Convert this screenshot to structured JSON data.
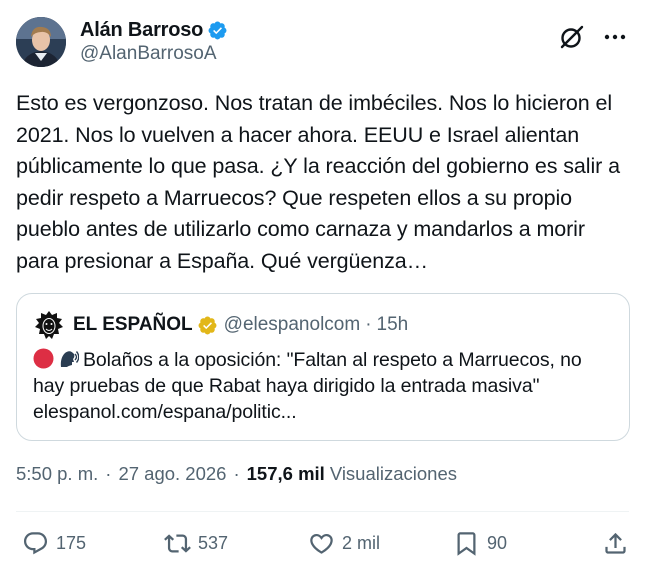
{
  "author": {
    "name": "Alán Barroso",
    "handle": "@AlanBarrosoA"
  },
  "icons": {
    "verified": "verified-badge-icon",
    "grok": "grok-icon",
    "more": "more-icon",
    "reply": "reply-icon",
    "retweet": "retweet-icon",
    "like": "heart-icon",
    "bookmark": "bookmark-icon",
    "share": "share-icon"
  },
  "tweet": {
    "text": "Esto es vergonzoso. Nos tratan de imbéciles. Nos lo hicieron el 2021. Nos lo vuelven a hacer ahora. EEUU e Israel alientan públicamente lo que pasa. ¿Y la reacción del gobierno es salir a pedir respeto a Marruecos? Que respeten ellos a su propio pueblo antes de utilizarlo como carnaza y mandarlos a morir para presionar a España. Qué vergüenza…"
  },
  "quote": {
    "name": "EL ESPAÑOL",
    "handle": "@elespanolcom",
    "separator": "·",
    "time": "15h",
    "text": "Bolaños a la oposición: \"Faltan al respeto a Marruecos, no hay pruebas de que Rabat haya dirigido la entrada masiva\"",
    "link": "elespanol.com/espana/politic..."
  },
  "meta": {
    "time": "5:50 p. m.",
    "date": "27 ago. 2026",
    "separator": "·",
    "views": "157,6 mil",
    "views_label": "Visualizaciones"
  },
  "actions": {
    "replies": "175",
    "retweets": "537",
    "likes": "2 mil",
    "bookmarks": "90"
  },
  "colors": {
    "text": "#0f1419",
    "secondary": "#536471",
    "border": "#cfd9de",
    "verified_blue": "#1d9bf0",
    "verified_gold": "#e2b719"
  }
}
